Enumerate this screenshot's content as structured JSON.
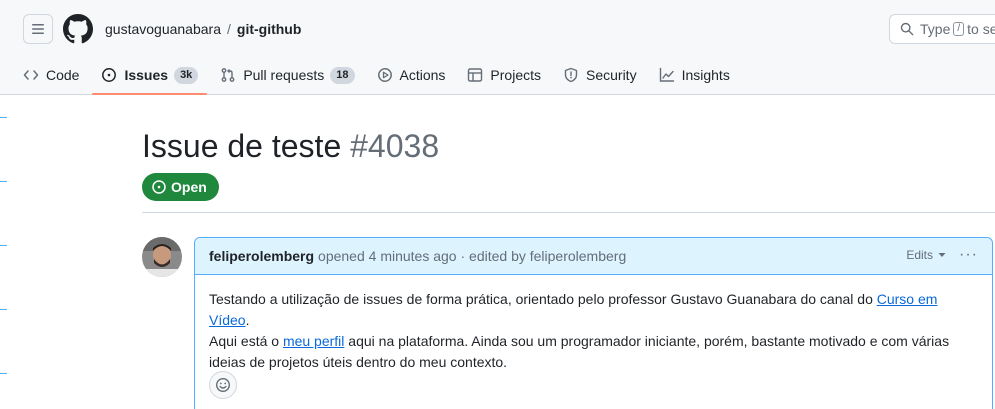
{
  "header": {
    "owner": "gustavoguanabara",
    "separator": "/",
    "repo": "git-github",
    "search": {
      "placeholder_before": "Type",
      "key": "/",
      "placeholder_after": "to se"
    }
  },
  "tabs": [
    {
      "label": "Code",
      "icon": "code-icon",
      "selected": false
    },
    {
      "label": "Issues",
      "icon": "issue-opened-icon",
      "counter": "3k",
      "selected": true
    },
    {
      "label": "Pull requests",
      "icon": "git-pull-request-icon",
      "counter": "18",
      "selected": false
    },
    {
      "label": "Actions",
      "icon": "play-icon",
      "selected": false
    },
    {
      "label": "Projects",
      "icon": "table-icon",
      "selected": false
    },
    {
      "label": "Security",
      "icon": "shield-icon",
      "selected": false
    },
    {
      "label": "Insights",
      "icon": "graph-icon",
      "selected": false
    }
  ],
  "issue": {
    "title": "Issue de teste",
    "number": "#4038",
    "state": "Open"
  },
  "comment": {
    "author": "feliperolemberg",
    "meta": "opened 4 minutes ago · ",
    "edited": "edited by feliperolemberg",
    "edits_label": "Edits",
    "more_label": "···",
    "line1_text": "Testando a utilização de issues de forma prática, orientado pelo professor Gustavo Guanabara do canal do ",
    "line1_link": "Curso em Vídeo",
    "line1_end": ".",
    "line2_text": "Aqui está o ",
    "line2_link": "meu perfil",
    "line2_rest": " aqui na plataforma. Ainda sou um programador iniciante, porém, bastante motivado e com várias ideias de projetos úteis dentro do meu contexto."
  },
  "colors": {
    "accent": "#0969da",
    "open_green": "#1f883d",
    "tab_underline": "#fd8c73",
    "comment_header_bg": "#ddf4ff",
    "comment_border": "#54aeff"
  }
}
